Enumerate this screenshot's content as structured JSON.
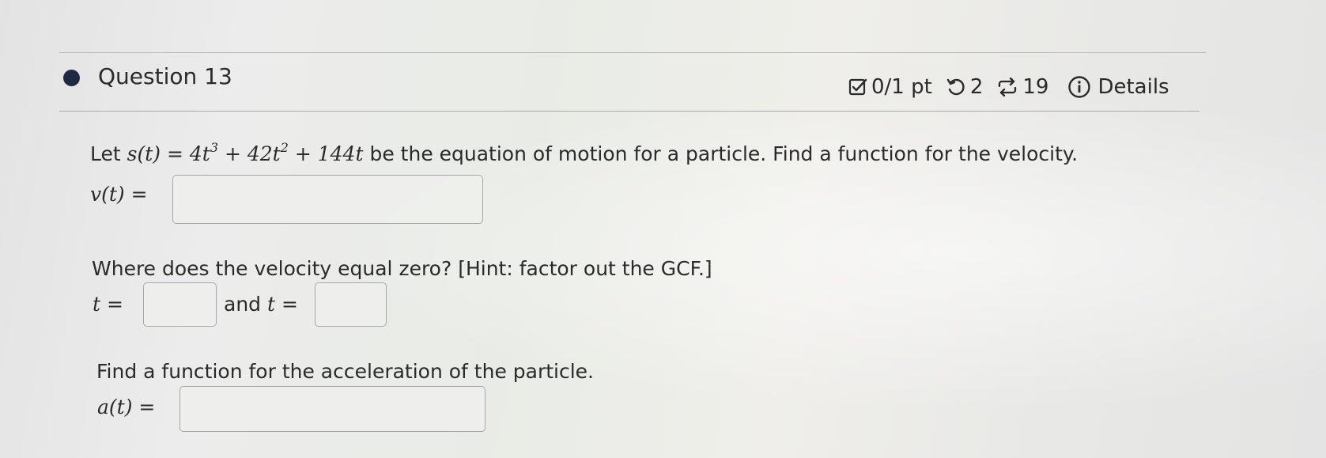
{
  "question": {
    "title": "Question 13",
    "score": "0/1 pt",
    "retries": "2",
    "submissions": "19",
    "details_label": "Details",
    "icons": {
      "bullet": "question-bullet-icon",
      "score": "checkbox-icon",
      "retries": "retry-icon",
      "submissions": "submissions-icon",
      "details": "info-icon"
    }
  },
  "part1": {
    "prompt_lead": "Let",
    "equation_lhs": "s(t)",
    "equation_rhs_parts": [
      "4t",
      "3",
      " + 42t",
      "2",
      " + 144t"
    ],
    "prompt_tail": "be the equation of motion for a particle. Find a function for the velocity.",
    "answer_label": "v(t)",
    "answer_value": ""
  },
  "part2": {
    "prompt": "Where does the velocity equal zero? [Hint: factor out the GCF.]",
    "answer1_label": "t",
    "connector": "and",
    "answer2_label": "t",
    "answer1_value": "",
    "answer2_value": ""
  },
  "part3": {
    "prompt": "Find a function for the acceleration of the particle.",
    "answer_label": "a(t)",
    "answer_value": ""
  },
  "colors": {
    "bullet": "#1e2a44",
    "text": "#2a2a2a",
    "box_border": "#a7a7a7"
  }
}
